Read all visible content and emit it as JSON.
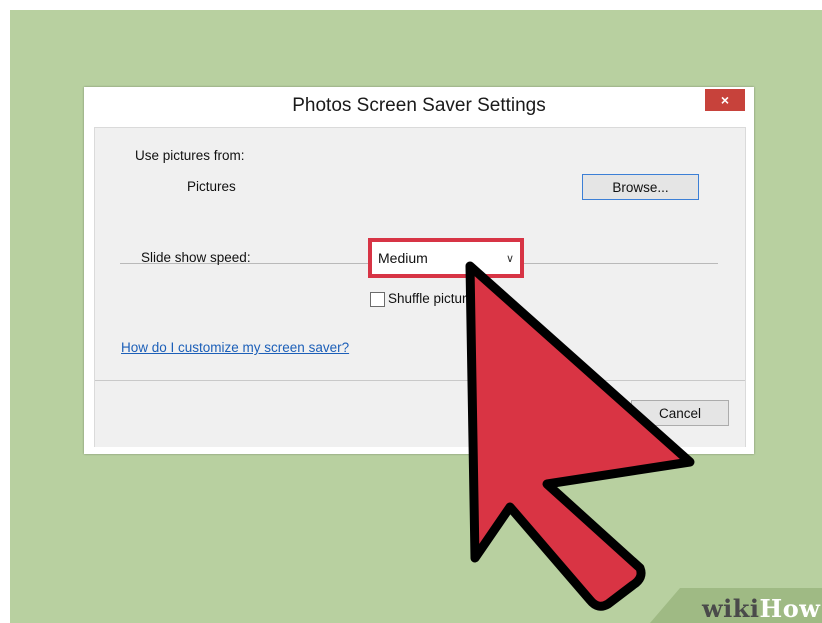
{
  "dialog": {
    "title": "Photos Screen Saver Settings",
    "close_label": "×"
  },
  "source": {
    "label": "Use pictures from:",
    "folder": "Pictures",
    "browse_label": "Browse..."
  },
  "speed": {
    "label": "Slide show speed:",
    "selected": "Medium",
    "chevron": "∨"
  },
  "shuffle": {
    "label": "Shuffle picture",
    "checked": false
  },
  "help_link": "How do I customize my screen saver?",
  "footer": {
    "cancel_label": "Cancel"
  },
  "watermark": {
    "part1": "wiki",
    "part2": "How"
  },
  "colors": {
    "background": "#b8d0a0",
    "highlight": "#d73445",
    "cursor_fill": "#d93444",
    "close_button": "#c7423b",
    "link": "#1c5fb8"
  },
  "icons": {
    "cursor": "arrow-pointer-icon",
    "dropdown": "chevron-down-icon",
    "close": "close-icon"
  }
}
